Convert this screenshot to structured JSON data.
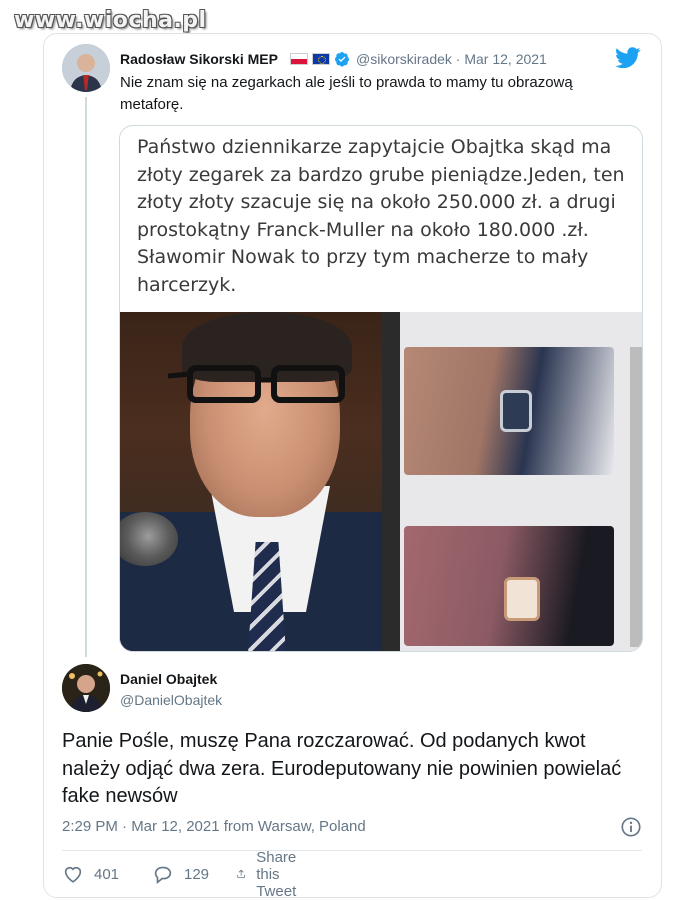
{
  "watermark": "www.wiocha.pl",
  "tweet1": {
    "author_name": "Radosław Sikorski MEP",
    "handle_date": "@sikorskiradek · Mar 12, 2021",
    "text": "Nie znam się na zegarkach ale jeśli to prawda to mamy tu obrazową metaforę.",
    "embedded_image_text": "Państwo dziennikarze zapytajcie Obajtka skąd ma złoty zegarek za bardzo grube pieniądze.Jeden, ten złoty złoty szacuje się na około 250.000 zł. a drugi prostokątny  Franck-Muller  na około 180.000 .zł. Sławomir Nowak to przy tym macherze to mały harcerzyk."
  },
  "tweet2": {
    "author_name": "Daniel Obajtek",
    "handle": "@DanielObajtek",
    "text": "Panie Pośle, muszę Pana rozczarować. Od podanych kwot należy odjąć dwa zera. Eurodeputowany nie powinien powielać fake newsów",
    "timestamp": "2:29 PM · Mar 12, 2021 from Warsaw, Poland",
    "likes": "401",
    "replies": "129",
    "share_label": "Share this Tweet"
  },
  "colors": {
    "accent": "#1da1f2",
    "secondary_text": "#657786",
    "border": "#cfd9de"
  },
  "icons": [
    "twitter-bird-icon",
    "verified-badge-icon",
    "info-icon",
    "heart-icon",
    "reply-icon",
    "share-icon"
  ]
}
